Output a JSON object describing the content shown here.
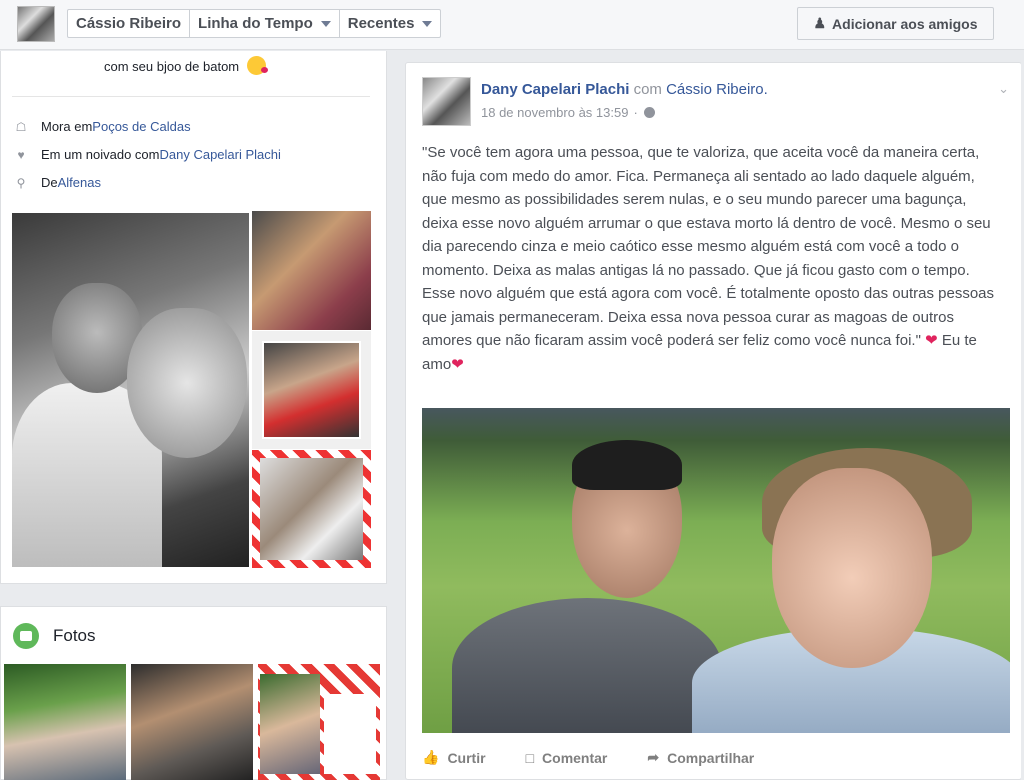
{
  "topbar": {
    "profile_name": "Cássio Ribeiro",
    "timeline_label": "Linha do Tempo",
    "recent_label": "Recentes",
    "add_friend_label": "Adicionar aos amigos"
  },
  "intro": {
    "bio": "com seu bjoo de batom",
    "lives_prefix": "Mora em ",
    "lives_place": "Poços de Caldas",
    "relationship_prefix": "Em um noivado com ",
    "relationship_partner": "Dany Capelari Plachi",
    "from_prefix": "De ",
    "from_place": "Alfenas"
  },
  "photos": {
    "title": "Fotos"
  },
  "post": {
    "author": "Dany Capelari Plachi",
    "with_text": "com",
    "tagged": "Cássio Ribeiro.",
    "timestamp": "18 de novembro às 13:59",
    "separator": "·",
    "body": "\"Se você tem agora uma pessoa, que te valoriza, que aceita você da maneira certa, não fuja com medo do amor. Fica. Permaneça ali sentado ao lado daquele alguém, que mesmo as possibilidades serem nulas, e o seu mundo parecer uma bagunça, deixa esse novo alguém arrumar o que estava morto lá dentro de você. Mesmo o seu dia parecendo cinza e meio caótico esse mesmo alguém está com você a todo o momento. Deixa as malas antigas lá no passado. Que já ficou gasto com o tempo. Esse novo alguém que está agora com você. É totalmente oposto das outras pessoas que jamais permaneceram. Deixa essa nova pessoa curar as magoas de outros amores que não ficaram assim você poderá ser feliz como você nunca foi.\"",
    "closing": "Eu te amo",
    "actions": {
      "like": "Curtir",
      "comment": "Comentar",
      "share": "Compartilhar"
    }
  },
  "icons": {
    "home": "home-icon",
    "heart": "heart-icon",
    "pin": "location-pin-icon",
    "globe": "globe-icon"
  },
  "colors": {
    "link": "#365899",
    "heart": "#e0245e",
    "photos_icon": "#5fb85a"
  }
}
